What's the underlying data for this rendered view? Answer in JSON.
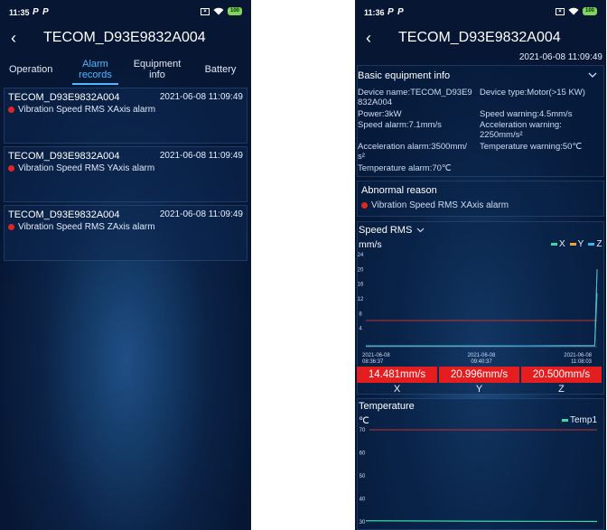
{
  "left": {
    "status": {
      "time": "11:35",
      "p1": "P",
      "p2": "P",
      "battery": "100"
    },
    "header": {
      "back": "‹",
      "title": "TECOM_D93E9832A004"
    },
    "tabs": [
      {
        "label": "Operation"
      },
      {
        "label": "Alarm\nrecords"
      },
      {
        "label": "Equipment\ninfo"
      },
      {
        "label": "Battery"
      }
    ],
    "records": [
      {
        "device": "TECOM_D93E9832A004",
        "time": "2021-06-08 11:09:49",
        "alarm": "Vibration Speed RMS XAxis alarm"
      },
      {
        "device": "TECOM_D93E9832A004",
        "time": "2021-06-08 11:09:49",
        "alarm": "Vibration Speed RMS YAxis alarm"
      },
      {
        "device": "TECOM_D93E9832A004",
        "time": "2021-06-08 11:09:49",
        "alarm": "Vibration Speed RMS ZAxis alarm"
      }
    ]
  },
  "right": {
    "status": {
      "time": "11:36",
      "p1": "P",
      "p2": "P",
      "battery": "100"
    },
    "header": {
      "back": "‹",
      "title": "TECOM_D93E9832A004"
    },
    "date": "2021-06-08 11:09:49",
    "basic": {
      "title": "Basic equipment info",
      "device_name_1": "Device name:TECOM_D93E9",
      "device_name_2": "832A004",
      "device_type": "Device type:Motor(>15 KW)",
      "power": "Power:3kW",
      "speed_warning": "Speed warning:4.5mm/s",
      "speed_alarm": "Speed alarm:7.1mm/s",
      "accel_warning_1": "Acceleration warning:",
      "accel_warning_2": "2250mm/s²",
      "accel_alarm_1": "Acceleration alarm:3500mm/",
      "accel_alarm_2": "s²",
      "temp_warning": "Temperature warning:50℃",
      "temp_alarm": "Temperature alarm:70℃"
    },
    "abnormal": {
      "title": "Abnormal reason",
      "reason": "Vibration Speed RMS XAxis alarm"
    },
    "speed": {
      "title": "Speed RMS",
      "unit": "mm/s",
      "legend": [
        "X",
        "Y",
        "Z"
      ],
      "values": [
        "14.481mm/s",
        "20.996mm/s",
        "20.500mm/s"
      ],
      "axes": [
        "X",
        "Y",
        "Z"
      ],
      "colors": {
        "X": "#3fd6a8",
        "Y": "#f0a531",
        "Z": "#37b7f0",
        "alarm_line": "#c0322f"
      }
    },
    "temperature": {
      "title": "Temperature",
      "unit": "℃",
      "legend": "Temp1",
      "color": "#3fd6a8"
    }
  },
  "chart_data": [
    {
      "type": "line",
      "title": "Speed RMS",
      "ylabel": "mm/s",
      "ylim": [
        0,
        24
      ],
      "yticks": [
        4,
        8,
        12,
        16,
        20,
        24
      ],
      "x_tick_labels": [
        "2021-06-08\n08:36:37",
        "2021-06-08\n09:40:37",
        "2021-06-08\n11:08:03"
      ],
      "reference_line": 7.1,
      "series": [
        {
          "name": "X",
          "x": [
            0,
            0.5,
            0.99,
            1.0
          ],
          "values": [
            0.2,
            0.2,
            0.3,
            14.5
          ]
        },
        {
          "name": "Y",
          "x": [
            0,
            0.5,
            0.99,
            1.0
          ],
          "values": [
            0.2,
            0.2,
            0.3,
            21.0
          ]
        },
        {
          "name": "Z",
          "x": [
            0,
            0.5,
            0.99,
            1.0
          ],
          "values": [
            0.2,
            0.2,
            0.3,
            20.5
          ]
        }
      ]
    },
    {
      "type": "line",
      "title": "Temperature",
      "ylabel": "℃",
      "ylim": [
        30,
        70
      ],
      "yticks": [
        30,
        40,
        50,
        60,
        70
      ],
      "reference_line": 70,
      "series": [
        {
          "name": "Temp1",
          "x": [
            0,
            0.5,
            1.0
          ],
          "values": [
            30.5,
            30.3,
            30.2
          ]
        }
      ]
    }
  ]
}
